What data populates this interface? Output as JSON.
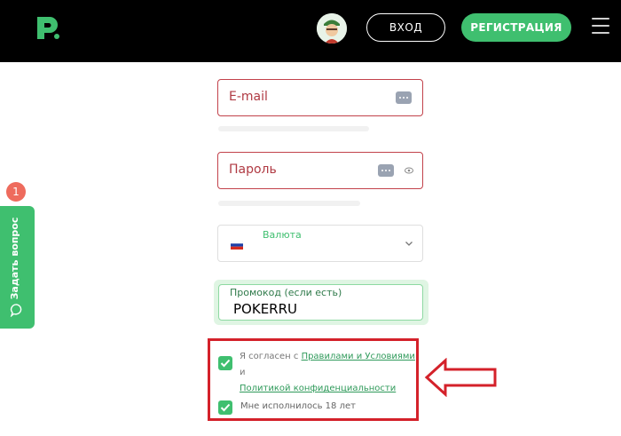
{
  "header": {
    "login_label": "ВХОД",
    "register_label": "РЕГИСТРАЦИЯ",
    "logo_icon": "pokerdom-logo-icon",
    "menu_icon": "hamburger-menu-icon"
  },
  "form": {
    "email_placeholder": "E-mail",
    "password_placeholder": "Пароль",
    "currency_label": "Валюта",
    "promo_label": "Промокод (если есть)",
    "promo_value": "POKERRU",
    "agree_prefix": "Я согласен с ",
    "terms_link": "Правилами и Условиями",
    "agree_and": " и",
    "privacy_link": "Политикой конфиденциальности",
    "age_label": "Мне исполнилось 18 лет",
    "terms_checked": true,
    "age_checked": true
  },
  "sidebar": {
    "ask_label": "Задать вопрос",
    "badge_count": "1"
  },
  "colors": {
    "brand_green": "#3fbf6f",
    "error_red": "#c2424b",
    "annotation_red": "#d4212a"
  }
}
